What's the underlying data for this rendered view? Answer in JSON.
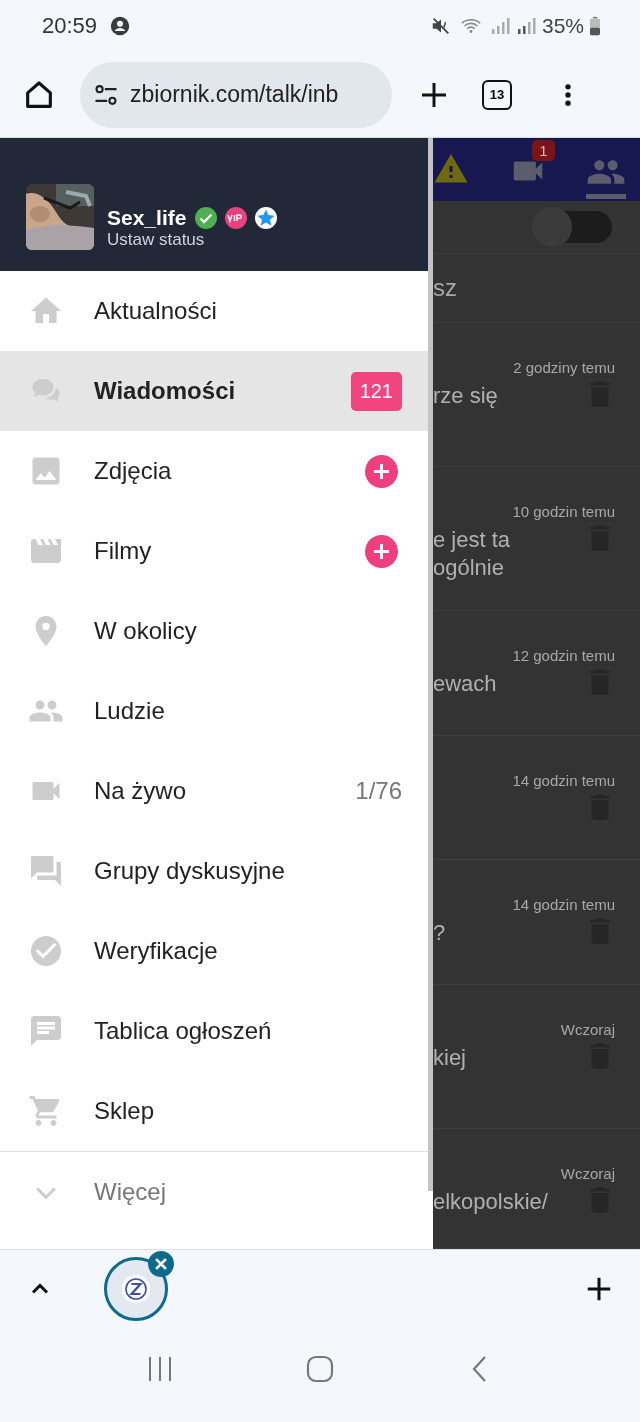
{
  "status_bar": {
    "time": "20:59",
    "battery": "35%"
  },
  "browser": {
    "url": "zbiornik.com/talk/inb",
    "tab_count": "13"
  },
  "drawer": {
    "user": {
      "name": "Sex_life",
      "status": "Ustaw status"
    },
    "items": [
      {
        "label": "Aktualności",
        "selected": false
      },
      {
        "label": "Wiadomości",
        "selected": true,
        "trailing": {
          "kind": "count",
          "text": "121"
        }
      },
      {
        "label": "Zdjęcia",
        "selected": false,
        "trailing": {
          "kind": "add"
        }
      },
      {
        "label": "Filmy",
        "selected": false,
        "trailing": {
          "kind": "add"
        }
      },
      {
        "label": "W okolicy",
        "selected": false
      },
      {
        "label": "Ludzie",
        "selected": false
      },
      {
        "label": "Na żywo",
        "selected": false,
        "trailing": {
          "kind": "text",
          "text": "1/76"
        }
      },
      {
        "label": "Grupy dyskusyjne",
        "selected": false
      },
      {
        "label": "Weryfikacje",
        "selected": false
      },
      {
        "label": "Tablica ogłoszeń",
        "selected": false
      },
      {
        "label": "Sklep",
        "selected": false
      }
    ],
    "more": {
      "label": "Więcej",
      "expanded": false
    }
  },
  "page": {
    "camera_badge": "1",
    "toggle": {
      "on": false
    },
    "search_text": "sz",
    "messages": [
      {
        "time": "2 godziny temu",
        "lines": [
          "rze się"
        ]
      },
      {
        "time": "10 godzin temu",
        "lines": [
          "e jest ta",
          "ogólnie"
        ]
      },
      {
        "time": "12 godzin temu",
        "lines": [
          "ewach"
        ]
      },
      {
        "time": "14 godzin temu"
      },
      {
        "time": "14 godzin temu",
        "lines": [
          "?"
        ]
      },
      {
        "time": "Wczoraj",
        "lines": [
          "kiej"
        ]
      },
      {
        "time": "Wczoraj",
        "lines": [
          "elkopolskie/"
        ]
      }
    ]
  }
}
